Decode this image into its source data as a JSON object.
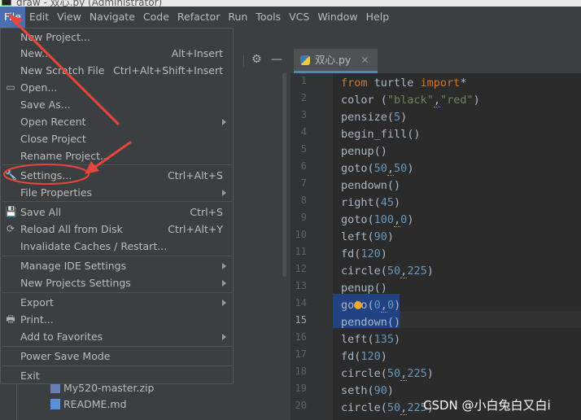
{
  "window": {
    "title": "draw - 双心.py (Administrator)"
  },
  "menubar": [
    "File",
    "Edit",
    "View",
    "Navigate",
    "Code",
    "Refactor",
    "Run",
    "Tools",
    "VCS",
    "Window",
    "Help"
  ],
  "file_menu": {
    "items": [
      {
        "label": "New Project...",
        "shortcut": ""
      },
      {
        "label": "New...",
        "shortcut": "Alt+Insert"
      },
      {
        "label": "New Scratch File",
        "shortcut": "Ctrl+Alt+Shift+Insert"
      },
      {
        "label": "Open...",
        "shortcut": ""
      },
      {
        "label": "Save As...",
        "shortcut": ""
      },
      {
        "label": "Open Recent",
        "shortcut": ""
      },
      {
        "label": "Close Project",
        "shortcut": ""
      },
      {
        "label": "Rename Project...",
        "shortcut": ""
      },
      {
        "label": "Settings...",
        "shortcut": "Ctrl+Alt+S"
      },
      {
        "label": "File Properties",
        "shortcut": ""
      },
      {
        "label": "Save All",
        "shortcut": "Ctrl+S"
      },
      {
        "label": "Reload All from Disk",
        "shortcut": "Ctrl+Alt+Y"
      },
      {
        "label": "Invalidate Caches / Restart...",
        "shortcut": ""
      },
      {
        "label": "Manage IDE Settings",
        "shortcut": ""
      },
      {
        "label": "New Projects Settings",
        "shortcut": ""
      },
      {
        "label": "Export",
        "shortcut": ""
      },
      {
        "label": "Print...",
        "shortcut": ""
      },
      {
        "label": "Add to Favorites",
        "shortcut": ""
      },
      {
        "label": "Power Save Mode",
        "shortcut": ""
      },
      {
        "label": "Exit",
        "shortcut": ""
      }
    ]
  },
  "editor": {
    "tab": "双心.py",
    "line_numbers": [
      "1",
      "2",
      "3",
      "4",
      "5",
      "6",
      "7",
      "8",
      "9",
      "10",
      "11",
      "12",
      "13",
      "14",
      "15",
      "16",
      "17",
      "18",
      "19",
      "20"
    ],
    "lines": [
      {
        "plain": "from turtle import*"
      },
      {
        "plain": "color (\"black\",\"red\")"
      },
      {
        "plain": "pensize(5)"
      },
      {
        "plain": "begin_fill()"
      },
      {
        "plain": "penup()"
      },
      {
        "plain": "goto(50,50)"
      },
      {
        "plain": "pendown()"
      },
      {
        "plain": "right(45)"
      },
      {
        "plain": "goto(100,0)"
      },
      {
        "plain": "left(90)"
      },
      {
        "plain": "fd(120)"
      },
      {
        "plain": "circle(50,225)"
      },
      {
        "plain": "penup()"
      },
      {
        "plain": "goto(0,0)"
      },
      {
        "plain": "pendown()"
      },
      {
        "plain": "left(135)"
      },
      {
        "plain": "fd(120)"
      },
      {
        "plain": "circle(50,225)"
      },
      {
        "plain": "seth(90)"
      },
      {
        "plain": "circle(50,225)"
      }
    ]
  },
  "project_tree": [
    {
      "label": "My520-master.zip"
    },
    {
      "label": "README.md"
    }
  ],
  "watermark": "CSDN @小白兔白又白i",
  "colors": {
    "accent": "#4b6eaf",
    "annotation": "#e8453c"
  }
}
